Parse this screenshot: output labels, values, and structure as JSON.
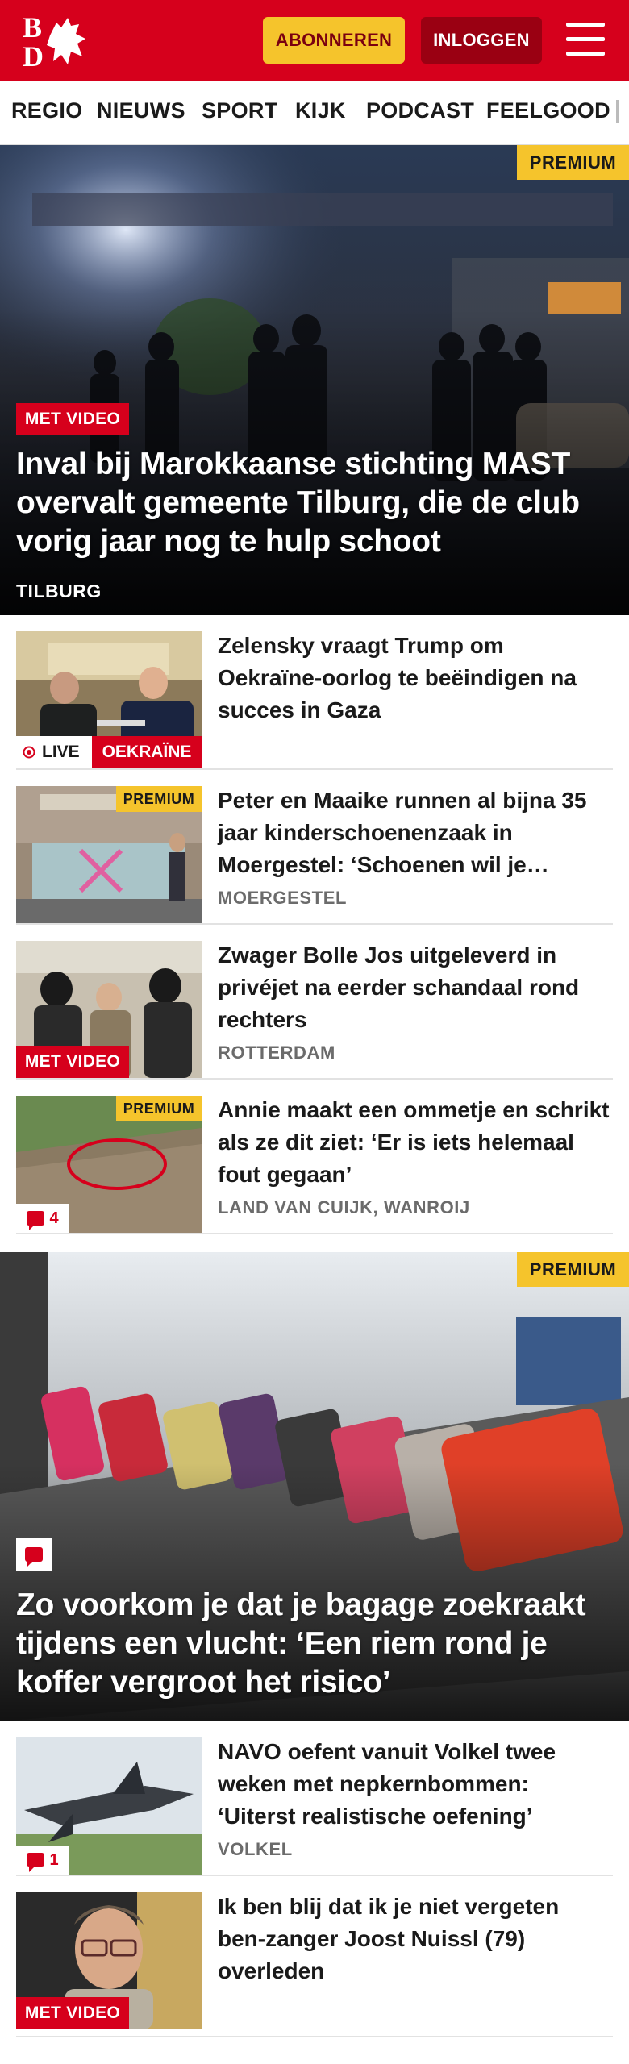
{
  "header": {
    "subscribe_label": "ABONNEREN",
    "login_label": "INLOGGEN",
    "brand_color": "#d6001c"
  },
  "nav": {
    "items": [
      "REGIO",
      "NIEUWS",
      "SPORT",
      "KIJK",
      "PODCAST",
      "FEELGOOD"
    ]
  },
  "hero1": {
    "premium": "PREMIUM",
    "video": "MET VIDEO",
    "title": "Inval bij Marokkaanse stichting MAST overvalt gemeente Tilburg, die de club vorig jaar nog te hulp schoot",
    "location": "TILBURG"
  },
  "articles": [
    {
      "title": "Zelensky vraagt Trump om Oekraïne-oorlog te beëindigen na succes in Gaza",
      "live": "LIVE",
      "topic": "OEKRAÏNE"
    },
    {
      "title": "Peter en Maaike runnen al bijna 35 jaar kinderschoenenzaak in Moergestel: ‘Schoenen wil je…",
      "location": "MOERGESTEL",
      "premium": "PREMIUM"
    },
    {
      "title": "Zwager Bolle Jos uitgeleverd in privéjet na eerder schandaal rond rechters",
      "location": "ROTTERDAM",
      "video": "MET VIDEO"
    },
    {
      "title": "Annie maakt een ommetje en schrikt als ze dit ziet: ‘Er is iets helemaal fout gegaan’",
      "location": "LAND VAN CUIJK, WANROIJ",
      "premium": "PREMIUM",
      "comments": "4"
    }
  ],
  "hero2": {
    "premium": "PREMIUM",
    "title": "Zo voorkom je dat je bagage zoekraakt tijdens een vlucht: ‘Een riem rond je koffer vergroot het risico’"
  },
  "articles2": [
    {
      "title": "NAVO oefent vanuit Volkel twee weken met nepkernbommen: ‘Uiterst realistische oefening’",
      "location": "VOLKEL",
      "comments": "1"
    },
    {
      "title": "Ik ben blij dat ik je niet vergeten ben-zanger Joost Nuissl (79) overleden",
      "video": "MET VIDEO"
    }
  ]
}
